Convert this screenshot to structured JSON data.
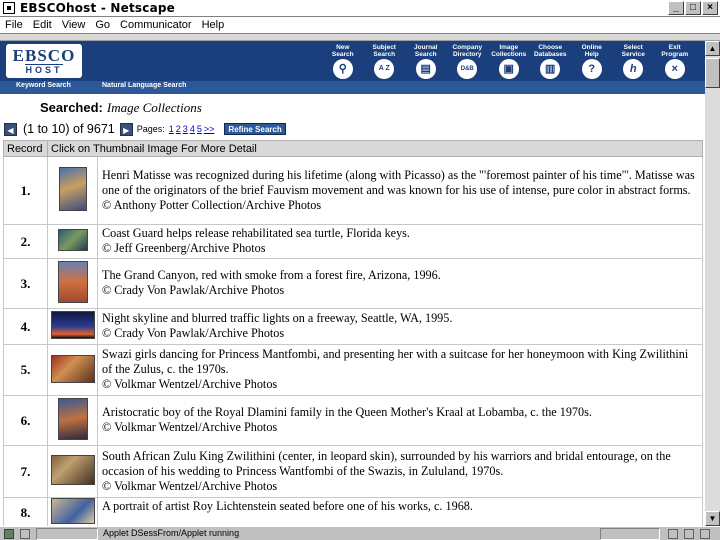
{
  "window": {
    "title": "EBSCOhost - Netscape",
    "min": "_",
    "max": "□",
    "close": "×"
  },
  "menu": [
    "File",
    "Edit",
    "View",
    "Go",
    "Communicator",
    "Help"
  ],
  "brand": {
    "line1": "EBSCO",
    "line2": "HOST",
    "color": "#1a3f7c"
  },
  "nav": [
    {
      "label": "New\nSearch",
      "icon": "magnifier-icon",
      "glyph": "🔍"
    },
    {
      "label": "Subject\nSearch",
      "icon": "a-z-icon",
      "glyph": "A Z"
    },
    {
      "label": "Journal\nSearch",
      "icon": "journal-icon",
      "glyph": "▤"
    },
    {
      "label": "Company\nDirectory",
      "icon": "directory-icon",
      "glyph": "D&B"
    },
    {
      "label": "Image\nCollections",
      "icon": "image-icon",
      "glyph": "▣"
    },
    {
      "label": "Choose\nDatabases",
      "icon": "database-icon",
      "glyph": "▥"
    },
    {
      "label": "Online\nHelp",
      "icon": "help-icon",
      "glyph": "?"
    },
    {
      "label": "Select\nService",
      "icon": "select-service-icon",
      "glyph": "h"
    },
    {
      "label": "Exit\nProgram",
      "icon": "exit-icon",
      "glyph": "×"
    }
  ],
  "subnav": {
    "keyword": "Keyword Search",
    "natural": "Natural Language Search"
  },
  "searched": {
    "label": "Searched:",
    "value": "Image Collections"
  },
  "pager": {
    "range": "(1 to 10) of 9671",
    "pages_label": "Pages:",
    "pages": [
      "1",
      "2",
      "3",
      "4",
      "5",
      ">>"
    ],
    "refine": "Refine Search"
  },
  "table": {
    "headers": [
      "Record",
      "Click on Thumbnail Image For More Detail"
    ],
    "rows": [
      {
        "num": "1.",
        "lines": [
          "Henri Matisse was recognized during his lifetime (along with Picasso) as the \"'foremost painter of his time\"'. Matisse was one of the originators of the brief Fauvism movement and was known for his use of intense, pure color in abstract forms.",
          "© Anthony Potter Collection/Archive Photos"
        ]
      },
      {
        "num": "2.",
        "lines": [
          "Coast Guard helps release rehabilitated sea turtle, Florida keys.",
          "© Jeff Greenberg/Archive Photos"
        ]
      },
      {
        "num": "3.",
        "lines": [
          "The Grand Canyon, red with smoke from a forest fire, Arizona, 1996.",
          "© Crady Von Pawlak/Archive Photos"
        ]
      },
      {
        "num": "4.",
        "lines": [
          "Night skyline and blurred traffic lights on a freeway, Seattle, WA, 1995.",
          "© Crady Von Pawlak/Archive Photos"
        ]
      },
      {
        "num": "5.",
        "lines": [
          "Swazi girls dancing for Princess Mantfombi, and presenting her with a suitcase for her honeymoon with King Zwilithini of the Zulus, c. the 1970s.",
          "© Volkmar Wentzel/Archive Photos"
        ]
      },
      {
        "num": "6.",
        "lines": [
          "Aristocratic boy of the Royal Dlamini family in the Queen Mother's Kraal at Lobamba, c. the 1970s.",
          "© Volkmar Wentzel/Archive Photos"
        ]
      },
      {
        "num": "7.",
        "lines": [
          "South African Zulu King Zwilithini (center, in leopard skin), surrounded by his warriors and bridal entourage, on the occasion of his wedding to Princess Wantfombi of the Swazis, in Zululand, 1970s.",
          "© Volkmar Wentzel/Archive Photos"
        ]
      },
      {
        "num": "8.",
        "lines": [
          "A portrait of artist Roy Lichtenstein seated before one of his works, c. 1968."
        ]
      }
    ]
  },
  "status": {
    "text": "Applet DSessFrom/Applet running"
  }
}
